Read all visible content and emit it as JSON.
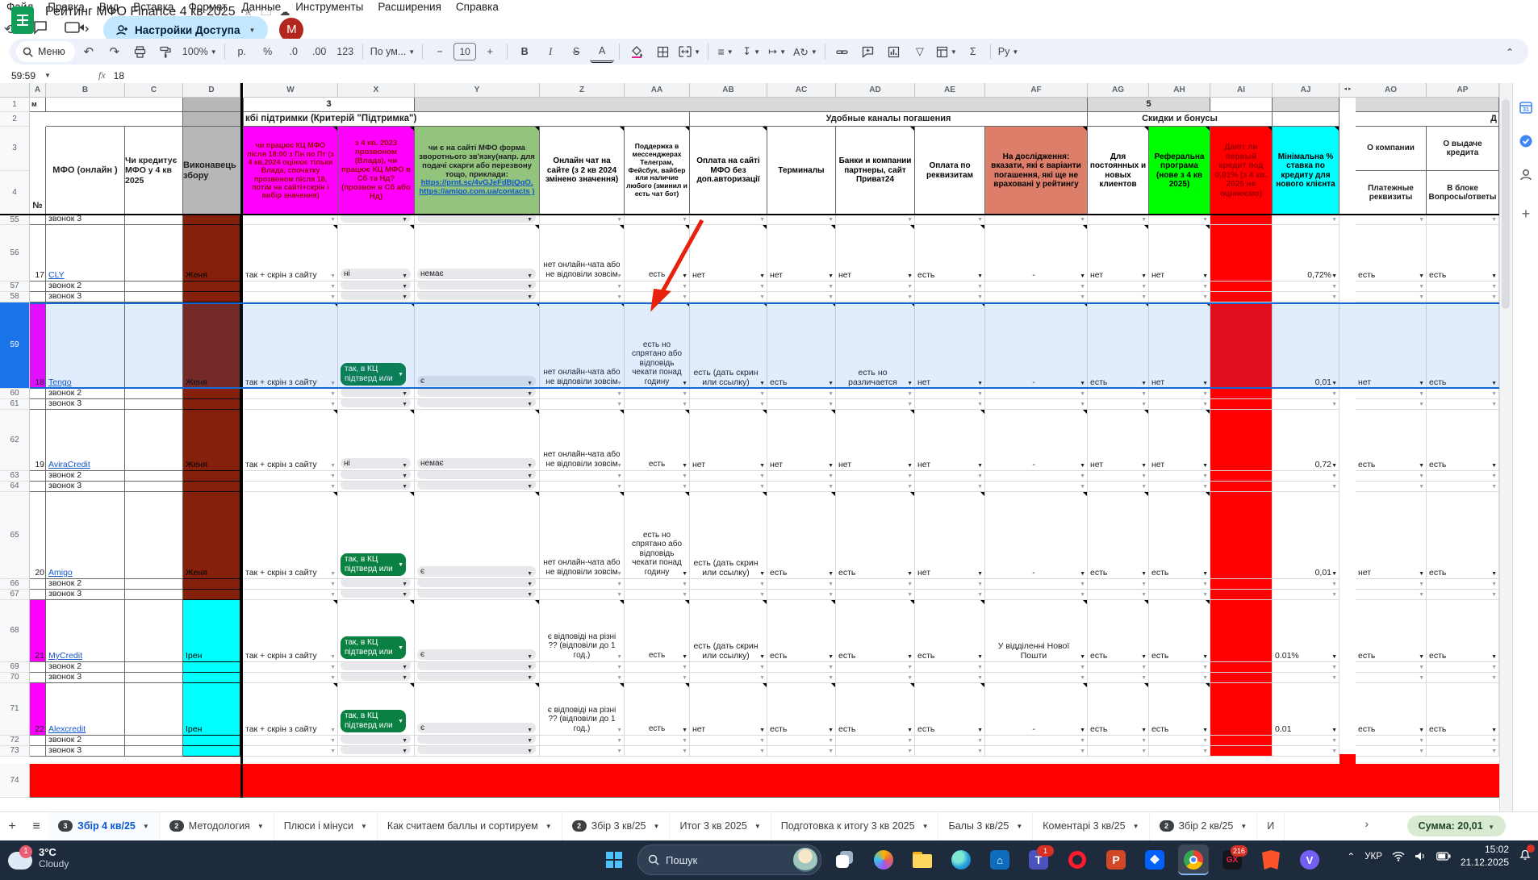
{
  "window": {
    "title": "Рейтинг МФО Finance 4 кв 2025",
    "menus": [
      "Файл",
      "Правка",
      "Вид",
      "Вставка",
      "Формат",
      "Данные",
      "Инструменты",
      "Расширения",
      "Справка"
    ],
    "share_button": "Настройки Доступа",
    "avatar_letter": "М"
  },
  "toolbar": {
    "menu_label": "Меню",
    "zoom": "100%",
    "currency": "р.",
    "percent": "%",
    "dec_decrease": ".0",
    "dec_increase": ".00",
    "more_formats": "123",
    "font_name": "По ум...",
    "font_size": "10",
    "minus": "−",
    "plus": "+",
    "bold": "B",
    "italic": "I",
    "strike": "S",
    "text_color": "A",
    "sigma": "Σ",
    "ruble_menu": "Ру",
    "collapse": "⌃"
  },
  "formula_bar": {
    "name_box": "59:59",
    "fx_label": "fx",
    "value": "18"
  },
  "grid": {
    "column_letters": [
      "A",
      "B",
      "C",
      "D",
      "W",
      "X",
      "Y",
      "Z",
      "AA",
      "AB",
      "AC",
      "AD",
      "AE",
      "AF",
      "AG",
      "AH",
      "AI",
      "AJ",
      "AO",
      "AP"
    ],
    "hidden_cols_marker": "◂ ▸",
    "row1": {
      "a": "м",
      "group3": "3",
      "group5": "5"
    },
    "row2": {
      "support": "кбі підтримки (Критерій \"Підтримка\")",
      "repay": "Удобные каналы погашения",
      "bonus": "Скидки и бонусы",
      "clipped_right": "Д"
    },
    "left_headers": {
      "A": "№",
      "B": "МФО (онлайн )",
      "C": "Чи кредитує МФО у 4 кв 2025",
      "D": "Виконавець збору"
    },
    "col_headers": {
      "W": "чи працює КЦ МФО після 18:00 з Пн по Пт (з 4 кв.2024 оцінює тільки Влада, спочатку прозвоном після 18, потім на сайті+скрін і вибір значення)",
      "X": "з 4 кв. 2023 прозвоном (Влада), чи працює КЦ МФО в Сб та Нд? (прозвон в Сб або Нд)",
      "Y_text": "чи є на сайті МФО форма зворотнього зв'язку(напр. для подачі скарги або перезвону тощо, приклади:",
      "Y_link1": "https://prnt.sc/4vGJeFdBjQqO,",
      "Y_link2": "https://amigo.com.ua/contacts )",
      "Z": "Онлайн чат на сайте (з 2 кв 2024 змінено значення)",
      "AA": "Поддержка в мессенджерах Телеграм, Фейсбук, вайбер или наличие любого (зминил и есть чат бот)",
      "AB": "Оплата на сайті МФО без доп.авторизації",
      "AC": "Терминалы",
      "AD": "Банки и компании партнеры, сайт Приват24",
      "AE": "Оплата по реквизитам",
      "AF": "На дослідження: вказати, які є варіанти погашення, які ще не враховані у рейтингу",
      "AG": "Для постоянных и новых клиентов",
      "AH": "Реферальна програма (нове з 4 кв 2025)",
      "AI": "Дают ли первый кредит под 0,01% (з 4 кв. 2025 не оцінюємо)",
      "AJ": "Мінімальна % ставка по кредиту для нового клієнта",
      "AO_top": "О компании",
      "AO_bottom": "Платежные реквизиты",
      "AP_top": "О выдаче кредита",
      "AP_bottom": "В блоке Вопросы/ответы"
    },
    "rows": [
      {
        "n": "55",
        "t": "call",
        "label": "звонок 3",
        "exec": "brick"
      },
      {
        "n": "56",
        "t": "mfo",
        "num": "17",
        "name": "CLY",
        "exec": "Женя",
        "execColor": "brick",
        "aMagenta": false,
        "sel": false,
        "W": "так + скрін з сайту",
        "Xchip": "gray",
        "Xtext": "ні",
        "Ytext": "немає",
        "Z": "нет онлайн-чата або не відповіли зовсім",
        "AA": "есть",
        "AB": "нет",
        "AC": "нет",
        "AD": "нет",
        "AE": "есть",
        "AF": "-",
        "AG": "нет",
        "AH": "нет",
        "AJ": "0,72%",
        "AJright": true,
        "AO": "есть",
        "AP": "есть"
      },
      {
        "n": "57",
        "t": "call",
        "label": "звонок 2",
        "exec": "brick"
      },
      {
        "n": "58",
        "t": "call",
        "label": "звонок 3",
        "exec": "brick"
      },
      {
        "n": "59",
        "t": "mfo",
        "num": "18",
        "name": "Tengo",
        "exec": "Женя",
        "execColor": "brick",
        "aMagenta": true,
        "sel": true,
        "W": "так + скрін з сайту",
        "Xchip": "green",
        "Xtext": "так, в КЦ підтверд или",
        "Ytext": "є",
        "Z": "нет онлайн-чата або не відповіли зовсім",
        "AA": "есть но спрятано або відповідь чекати понад годину",
        "AB": "есть (дать скрин или ссылку)",
        "AC": "есть",
        "AD": "есть но различается",
        "AE": "нет",
        "AF": "-",
        "AG": "есть",
        "AH": "нет",
        "AJ": "0,01",
        "AJright": true,
        "AO": "нет",
        "AP": "есть"
      },
      {
        "n": "60",
        "t": "call",
        "label": "звонок 2",
        "exec": "brick"
      },
      {
        "n": "61",
        "t": "call",
        "label": "звонок 3",
        "exec": "brick"
      },
      {
        "n": "62",
        "t": "mfo",
        "num": "19",
        "name": "AviraCredit",
        "exec": "Женя",
        "execColor": "brick",
        "aMagenta": false,
        "sel": false,
        "W": "так + скрін з сайту",
        "Xchip": "gray",
        "Xtext": "ні",
        "Ytext": "немає",
        "Z": "нет онлайн-чата або не відповіли зовсім",
        "AA": "есть",
        "AB": "нет",
        "AC": "нет",
        "AD": "нет",
        "AE": "нет",
        "AF": "-",
        "AG": "нет",
        "AH": "нет",
        "AJ": "0,72",
        "AJright": true,
        "AO": "есть",
        "AP": "есть"
      },
      {
        "n": "63",
        "t": "call",
        "label": "звонок 2",
        "exec": "brick"
      },
      {
        "n": "64",
        "t": "call",
        "label": "звонок 3",
        "exec": "brick"
      },
      {
        "n": "65",
        "t": "mfo",
        "num": "20",
        "name": "Amigo",
        "exec": "Женя",
        "execColor": "brick",
        "aMagenta": false,
        "sel": false,
        "W": "так + скрін з сайту",
        "Xchip": "green",
        "Xtext": "так, в КЦ підтверд или",
        "Ytext": "є",
        "Z": "нет онлайн-чата або не відповіли зовсім",
        "AA": "есть но спрятано або відповідь чекати понад годину",
        "AB": "есть (дать скрин или ссылку)",
        "AC": "есть",
        "AD": "есть",
        "AE": "нет",
        "AF": "-",
        "AG": "есть",
        "AH": "есть",
        "AJ": "0,01",
        "AJright": true,
        "AO": "нет",
        "AP": "есть"
      },
      {
        "n": "66",
        "t": "call",
        "label": "звонок 2",
        "exec": "brick"
      },
      {
        "n": "67",
        "t": "call",
        "label": "звонок 3",
        "exec": "brick"
      },
      {
        "n": "68",
        "t": "mfo",
        "num": "21",
        "name": "MyCredit",
        "exec": "Ірен",
        "execColor": "cyan",
        "aMagenta": true,
        "sel": false,
        "W": "так + скрін з сайту",
        "Xchip": "green",
        "Xtext": "так, в КЦ підтверд или",
        "Ytext": "є",
        "Z": "є відповіді на різні ?? (відповіли до 1 год.)",
        "AA": "есть",
        "AB": "есть (дать скрин или ссылку)",
        "AC": "есть",
        "AD": "есть",
        "AE": "есть",
        "AF": "У відділенні Нової Пошти",
        "AG": "есть",
        "AH": "есть",
        "AJ": "0.01%",
        "AJright": false,
        "AO": "есть",
        "AP": "есть"
      },
      {
        "n": "69",
        "t": "call",
        "label": "звонок 2",
        "exec": "cyan"
      },
      {
        "n": "70",
        "t": "call",
        "label": "звонок 3",
        "exec": "cyan"
      },
      {
        "n": "71",
        "t": "mfo",
        "num": "22",
        "name": "Alexcredit",
        "exec": "Ірен",
        "execColor": "cyan",
        "aMagenta": true,
        "sel": false,
        "W": "так + скрін з сайту",
        "Xchip": "green",
        "Xtext": "так, в КЦ підтверд или",
        "Ytext": "є",
        "Z": "є відповіді на різні ?? (відповіли до 1 год.)",
        "AA": "есть",
        "AB": "нет",
        "AC": "есть",
        "AD": "есть",
        "AE": "есть",
        "AF": "-",
        "AG": "есть",
        "AH": "есть",
        "AJ": "0.01",
        "AJright": false,
        "AO": "есть",
        "AP": "есть"
      },
      {
        "n": "72",
        "t": "call",
        "label": "звонок 2",
        "exec": "cyan"
      },
      {
        "n": "73",
        "t": "call",
        "label": "звонок 3",
        "exec": "cyan"
      },
      {
        "n": "74",
        "t": "red"
      }
    ],
    "colors": {
      "magenta": "#ff00ff",
      "header_red_text": "#990000",
      "green": "#93c47d",
      "salmon": "#dd7e6b",
      "bright_green": "#00ff00",
      "red": "#ff0000",
      "cyan": "#00ffff",
      "brick": "#85200c",
      "gray_hdr": "#b7b7b7",
      "chip_green": "#0b8043",
      "selection": "#1a73e8",
      "link": "#1155cc"
    }
  },
  "sheet_tabs": {
    "add": "+",
    "all_sheets": "≡",
    "clip_nav": "›",
    "sum_chip": "Сумма: 20,01",
    "tabs": [
      {
        "badge": "3",
        "label": "Збір 4 кв/25",
        "active": true,
        "underline": "red",
        "arrow": true
      },
      {
        "badge": "2",
        "label": "Методология",
        "arrow": true
      },
      {
        "label": "Плюси і мінуси",
        "arrow": true
      },
      {
        "label": "Как считаем баллы и сортируем",
        "arrow": true
      },
      {
        "badge": "2",
        "label": "Збір 3 кв/25",
        "underline": "red",
        "arrow": true
      },
      {
        "label": "Итог 3 кв 2025",
        "underline": "green",
        "arrow": true
      },
      {
        "label": "Подготовка к итогу 3 кв  2025",
        "underline": "green",
        "arrow": true
      },
      {
        "label": "Балы 3 кв/25",
        "arrow": true
      },
      {
        "label": "Коментарі 3 кв/25",
        "arrow": true
      },
      {
        "badge": "2",
        "label": "Збір 2 кв/25",
        "underline": "red",
        "arrow": true
      },
      {
        "label": "И",
        "clipped": true
      }
    ]
  },
  "taskbar": {
    "weather_temp": "3°C",
    "weather_desc": "Cloudy",
    "weather_badge": "1",
    "search_placeholder": "Пошук",
    "icons": [
      {
        "name": "start-button"
      },
      {
        "name": "search-box"
      },
      {
        "name": "task-view"
      },
      {
        "name": "copilot"
      },
      {
        "name": "file-explorer"
      },
      {
        "name": "edge"
      },
      {
        "name": "store"
      },
      {
        "name": "teams",
        "badge": "1"
      },
      {
        "name": "opera"
      },
      {
        "name": "powerpoint"
      },
      {
        "name": "dropbox"
      },
      {
        "name": "chrome",
        "active": true
      },
      {
        "name": "opera-gx",
        "badge": "216"
      },
      {
        "name": "brave"
      },
      {
        "name": "viber"
      }
    ],
    "tray": {
      "lang": "УКР",
      "time": "15:02",
      "date": "21.12.2025"
    }
  }
}
